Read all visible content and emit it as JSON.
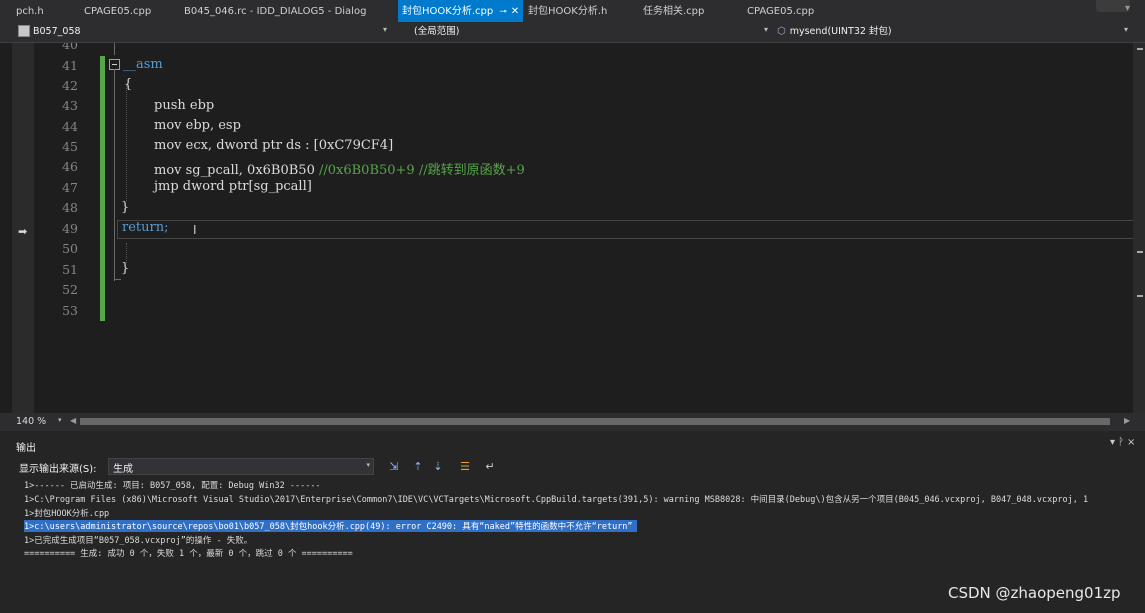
{
  "tabs": [
    {
      "label": "pch.h"
    },
    {
      "label": "CPAGE05.cpp"
    },
    {
      "label": "B045_046.rc - IDD_DIALOG5 - Dialog"
    },
    {
      "label": "封包HOOK分析.cpp",
      "active": true
    },
    {
      "label": "封包HOOK分析.h"
    },
    {
      "label": "任务相关.cpp"
    },
    {
      "label": "CPAGE05.cpp"
    }
  ],
  "navbar": {
    "project": "B057_058",
    "scope": "(全局范围)",
    "function": "mysend(UINT32 封包)"
  },
  "editor": {
    "zoom": "140 %",
    "first_partial_line": "40",
    "lines": [
      {
        "no": "41",
        "text": "__asm"
      },
      {
        "no": "42",
        "text": "{"
      },
      {
        "no": "43",
        "text": "push ebp"
      },
      {
        "no": "44",
        "text": "mov ebp, esp"
      },
      {
        "no": "45",
        "text": "mov ecx, dword ptr ds : [0xC79CF4]"
      },
      {
        "no": "46",
        "code": "mov sg_pcall, 0x6B0B50 ",
        "comment": "//0x6B0B50+9 //跳转到原函数+9"
      },
      {
        "no": "47",
        "text": "jmp dword ptr[sg_pcall]"
      },
      {
        "no": "48",
        "text": "}"
      },
      {
        "no": "49",
        "text": "return;"
      },
      {
        "no": "50",
        "text": ""
      },
      {
        "no": "51",
        "text": "}"
      },
      {
        "no": "52",
        "text": ""
      },
      {
        "no": "53",
        "text": ""
      }
    ]
  },
  "output": {
    "title": "输出",
    "source_label": "显示输出来源(S):",
    "source_value": "生成",
    "lines": [
      "1>------ 已启动生成: 项目: B057_058, 配置: Debug Win32 ------",
      "1>C:\\Program Files (x86)\\Microsoft Visual Studio\\2017\\Enterprise\\Common7\\IDE\\VC\\VCTargets\\Microsoft.CppBuild.targets(391,5): warning MSB8028: 中间目录(Debug\\)包含从另一个项目(B045_046.vcxproj, B047_048.vcxproj, 1",
      "1>封包HOOK分析.cpp",
      "1>c:\\users\\administrator\\source\\repos\\bo01\\b057_058\\封包hook分析.cpp(49): error C2490: 具有“naked”特性的函数中不允许“return”",
      "1>已完成生成项目“B057_058.vcxproj”的操作 - 失败。",
      "========== 生成: 成功 0 个，失败 1 个，最新 0 个，跳过 0 个 =========="
    ]
  },
  "watermark": "CSDN @zhaopeng01zp",
  "colors": {
    "active_tab": "#007acc",
    "keyword": "#569cd6",
    "comment": "#57a64a",
    "error_highlight": "#2f6fc6"
  }
}
